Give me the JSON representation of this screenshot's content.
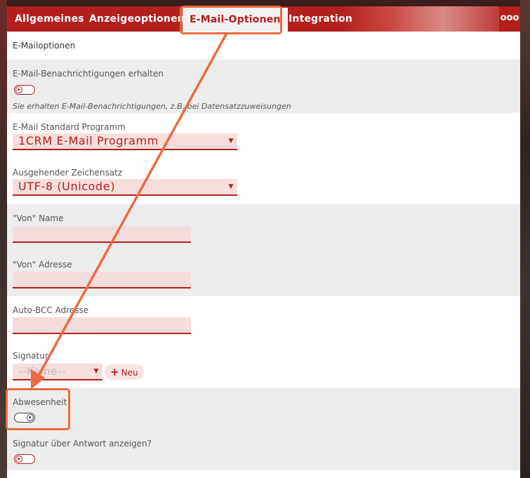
{
  "tabs": {
    "allgemeines": "Allgemeines",
    "anzeigeoptionen": "Anzeigeoptionen",
    "email_optionen": "E-Mail-Optionen",
    "integration": "Integration",
    "more": "ooo"
  },
  "section_title": "E-Mailoptionen",
  "notifications": {
    "label": "E-Mail-Benachrichtigungen erhalten",
    "hint": "Sie erhalten E-Mail-Benachrichtigungen, z.B. bei Datensatzzuweisungen",
    "state": "off"
  },
  "default_program": {
    "label": "E-Mail Standard Programm",
    "value": "1CRM E-Mail Programm"
  },
  "charset": {
    "label": "Ausgehender Zeichensatz",
    "value": "UTF-8 (Unicode)"
  },
  "from_name": {
    "label": "\"Von\" Name",
    "value": ""
  },
  "from_address": {
    "label": "\"Von\" Adresse",
    "value": ""
  },
  "auto_bcc": {
    "label": "Auto-BCC Adresse",
    "value": ""
  },
  "signature": {
    "label": "Signatur",
    "value": "--Keine--",
    "new_button": "Neu"
  },
  "absence": {
    "label": "Abwesenheit",
    "state": "on"
  },
  "signature_above_reply": {
    "label": "Signatur über Antwort anzeigen?",
    "state": "off"
  },
  "colors": {
    "accent": "#b3201c",
    "annotation": "#ec6a3f",
    "field_bg": "#f3dcdc"
  }
}
